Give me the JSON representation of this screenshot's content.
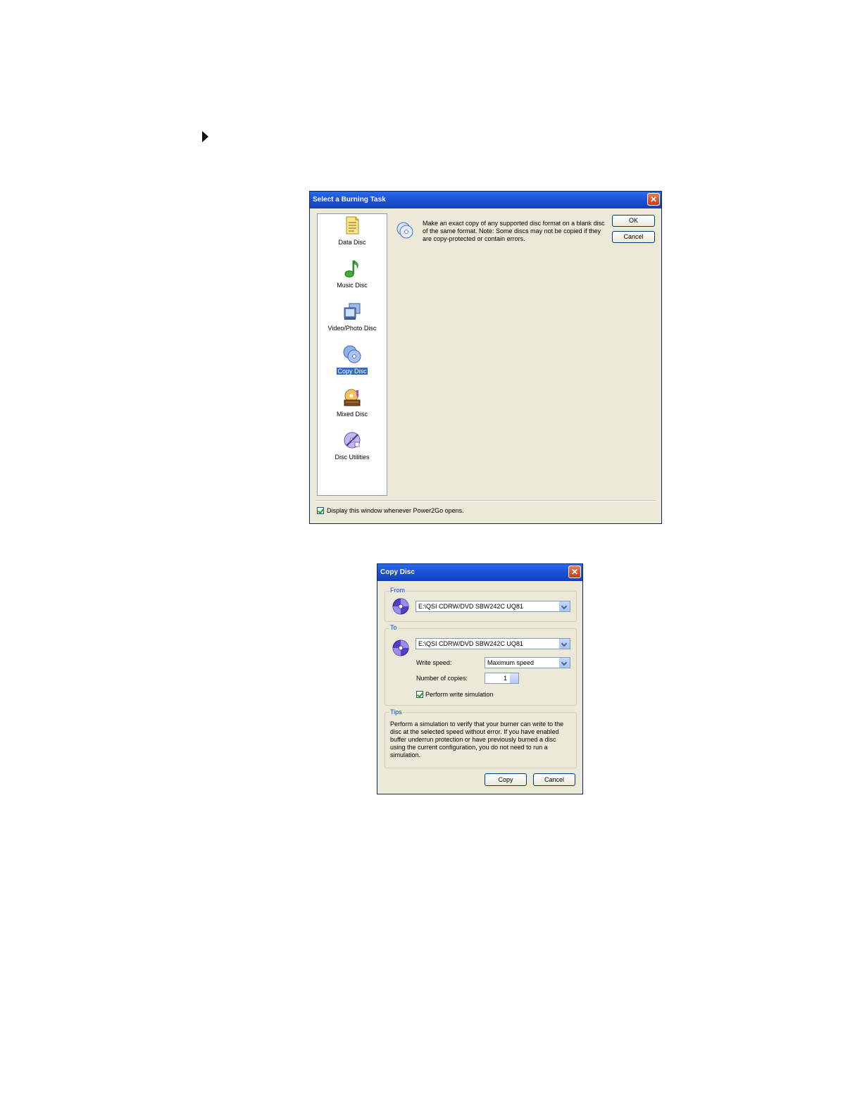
{
  "burning_dialog": {
    "title": "Select a Burning Task",
    "tasks": [
      {
        "label": "Data Disc",
        "icon": "document-icon"
      },
      {
        "label": "Music Disc",
        "icon": "music-note-icon"
      },
      {
        "label": "Video/Photo Disc",
        "icon": "film-icon"
      },
      {
        "label": "Copy Disc",
        "icon": "copy-disc-icon",
        "selected": true
      },
      {
        "label": "Mixed Disc",
        "icon": "mixed-disc-icon"
      },
      {
        "label": "Disc Utilities",
        "icon": "disc-utilities-icon"
      }
    ],
    "description": "Make an exact copy of any supported disc format on a blank disc of the same format. Note: Some discs may not be copied if they are copy-protected or contain errors.",
    "ok_label": "OK",
    "cancel_label": "Cancel",
    "display_checkbox_label": "Display this window whenever Power2Go opens.",
    "display_checkbox_checked": true
  },
  "copy_dialog": {
    "title": "Copy Disc",
    "from_label": "From",
    "from_drive": "E:\\QSI CDRW/DVD SBW242C UQ81",
    "to_label": "To",
    "to_drive": "E:\\QSI CDRW/DVD SBW242C UQ81",
    "write_speed_label": "Write speed:",
    "write_speed_value": "Maximum speed",
    "copies_label": "Number of copies:",
    "copies_value": "1",
    "simulation_label": "Perform write simulation",
    "simulation_checked": true,
    "tips_label": "Tips",
    "tips_text": "Perform a simulation to verify that your burner can write to the disc at the selected speed without error. If you have enabled buffer underrun protection or have previously burned a disc using the current configuration, you do not need to run a simulation.",
    "copy_label": "Copy",
    "cancel_label": "Cancel"
  },
  "colors": {
    "titlebar": "#1c52d6",
    "dialog_bg": "#ece9d8",
    "selection": "#316ac5"
  }
}
